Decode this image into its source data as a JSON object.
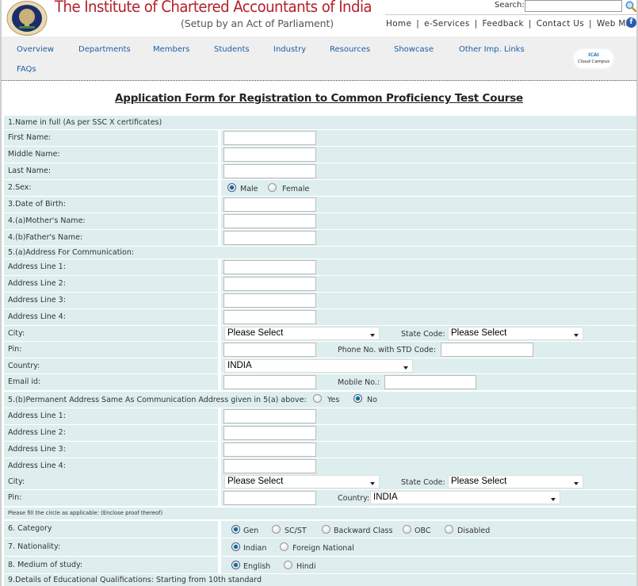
{
  "header": {
    "title": "The Institute of Chartered Accountants of India",
    "subtitle": "(Setup by an Act of Parliament)",
    "search_label": "Search:",
    "search_value": "",
    "top_links": [
      "Home",
      "e-Services",
      "Feedback",
      "Contact Us",
      "Web Mail"
    ],
    "facebook_glyph": "f"
  },
  "nav": {
    "items": [
      "Overview",
      "Departments",
      "Members",
      "Students",
      "Industry",
      "Resources",
      "Showcase",
      "Other Imp. Links",
      "FAQs"
    ],
    "cloud_line1": "ICAI",
    "cloud_line2": "Cloud Campus"
  },
  "form": {
    "title": "Application Form for Registration to Common Proficiency Test Course",
    "name_section": "1.Name in full (As per SSC X certificates)",
    "first_name": "First Name:",
    "middle_name": "Middle Name:",
    "last_name": "Last Name:",
    "sex": {
      "label": "2.Sex:",
      "options": [
        "Male",
        "Female"
      ],
      "selected": "Male"
    },
    "dob": "3.Date of Birth:",
    "mother_name": "4.(a)Mother's Name:",
    "father_name": "4.(b)Father's Name:",
    "comm_address": {
      "section": "5.(a)Address For Communication:",
      "line1": "Address Line 1:",
      "line2": "Address Line 2:",
      "line3": "Address Line 3:",
      "line4": "Address Line 4:",
      "city": "City:",
      "city_value": "Please Select",
      "state_code": "State Code:",
      "state_value": "Please Select",
      "pin": "Pin:",
      "phone": "Phone No. with STD Code:",
      "country": "Country:",
      "country_value": "INDIA",
      "email": "Email id:",
      "mobile": "Mobile No.:"
    },
    "perm_address": {
      "section": "5.(b)Permanent Address Same As Communication Address given in 5(a) above:",
      "options": [
        "Yes",
        "No"
      ],
      "selected": "No",
      "line1": "Address Line 1:",
      "line2": "Address Line 2:",
      "line3": "Address Line 3:",
      "line4": "Address Line 4:",
      "city": "City:",
      "city_value": "Please Select",
      "state_code": "State Code:",
      "state_value": "Please Select",
      "pin": "Pin:",
      "country": "Country:",
      "country_value": "INDIA"
    },
    "fill_note": "Please fill the circle as applicable: (Enclose proof thereof)",
    "category": {
      "label": "6. Category",
      "options": [
        "Gen",
        "SC/ST",
        "Backward Class",
        "OBC",
        "Disabled"
      ],
      "selected": "Gen"
    },
    "nationality": {
      "label": "7. Nationality:",
      "options": [
        "Indian",
        "Foreign National"
      ],
      "selected": "Indian"
    },
    "medium": {
      "label": "8. Medium of study:",
      "options": [
        "English",
        "Hindi"
      ],
      "selected": "English"
    },
    "education": "9.Details of Educational Qualifications: Starting from 10th standard"
  }
}
